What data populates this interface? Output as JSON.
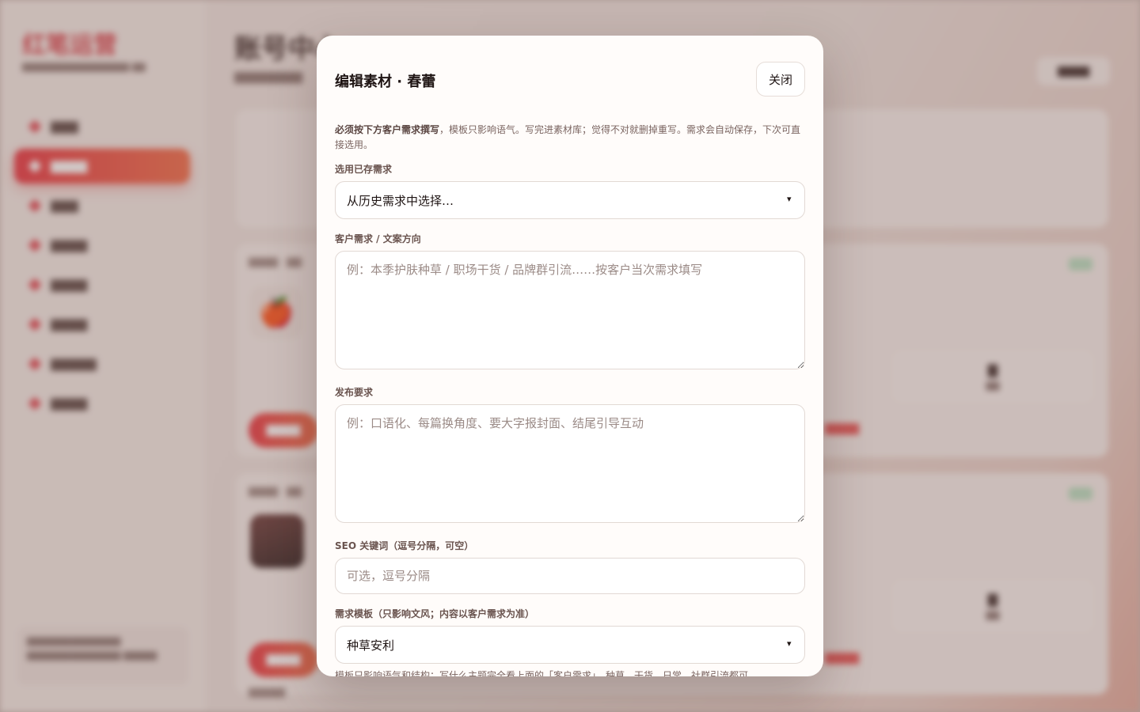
{
  "modal": {
    "title": "编辑素材 · 春蕾",
    "close_label": "关闭",
    "intro_bold": "必须按下方客户需求撰写",
    "intro_rest": "，模板只影响语气。写完进素材库；觉得不对就删掉重写。需求会自动保存，下次可直接选用。",
    "saved_label": "选用已存需求",
    "saved_value": "从历史需求中选择…",
    "demand_label": "客户需求 / 文案方向",
    "demand_placeholder": "例：本季护肤种草 / 职场干货 / 品牌群引流……按客户当次需求填写",
    "publish_label": "发布要求",
    "publish_placeholder": "例：口语化、每篇换角度、要大字报封面、结尾引导互动",
    "seo_label": "SEO 关键词（逗号分隔，可空）",
    "seo_placeholder": "可选，逗号分隔",
    "template_label": "需求模板（只影响文风；内容以客户需求为准）",
    "template_value": "种草安利",
    "template_hint": "模板只影响语气和结构；写什么主题完全看上面的「客户需求」。种草、干货、日常、社群引流都可。",
    "select_arrow": "▾"
  },
  "background": {
    "brand": "红笔运营",
    "page_title": "账号中心",
    "apple": "🍎"
  }
}
